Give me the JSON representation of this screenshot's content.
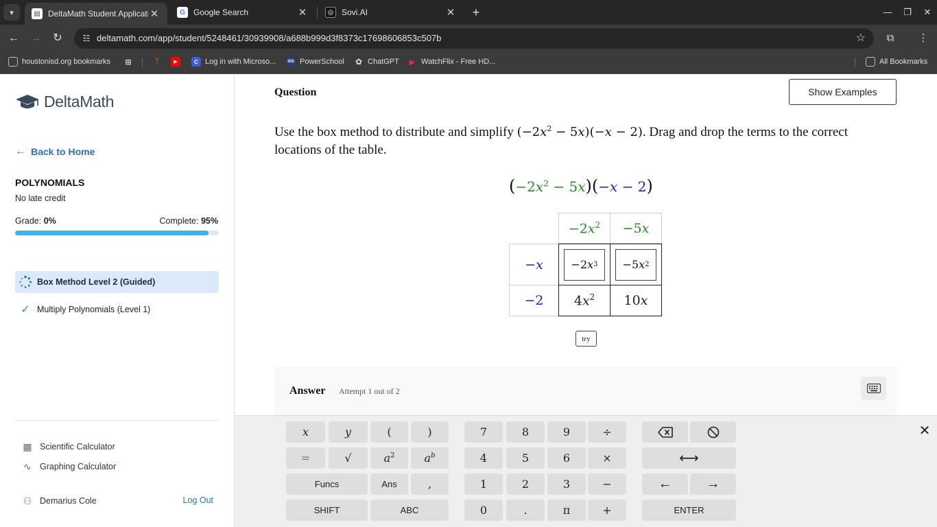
{
  "browser": {
    "tabs": [
      {
        "title": "DeltaMath Student Application",
        "active": true
      },
      {
        "title": "Google Search",
        "active": false
      },
      {
        "title": "Sovi.AI",
        "active": false
      }
    ],
    "url": "deltamath.com/app/student/5248461/30939908/a688b999d3f8373c17698606853c507b",
    "bookmarks": [
      {
        "label": "houstonisd.org bookmarks"
      },
      {
        "label": "Log in with Microso..."
      },
      {
        "label": "PowerSchool"
      },
      {
        "label": "ChatGPT"
      },
      {
        "label": "WatchFlix - Free HD..."
      }
    ],
    "all_bookmarks": "All Bookmarks"
  },
  "sidebar": {
    "brand": "DeltaMath",
    "back_label": "Back to Home",
    "assignment_title": "POLYNOMIALS",
    "assignment_sub": "No late credit",
    "grade_label": "Grade:",
    "grade_value": "0%",
    "complete_label": "Complete:",
    "complete_value": "95%",
    "complete_fraction": 0.95,
    "skills": [
      {
        "label": "Box Method Level 2 (Guided)",
        "status": "in-progress"
      },
      {
        "label": "Multiply Polynomials (Level 1)",
        "status": "complete"
      }
    ],
    "tools": [
      {
        "label": "Scientific Calculator"
      },
      {
        "label": "Graphing Calculator"
      }
    ],
    "user_name": "Demarius Cole",
    "logout_label": "Log Out"
  },
  "question": {
    "heading": "Question",
    "show_examples": "Show Examples",
    "prompt_before": "Use the box method to distribute and simplify ",
    "prompt_after": ". Drag and drop the terms to the correct locations of the table.",
    "try_label": "try"
  },
  "answer": {
    "label": "Answer",
    "attempt": "Attempt 1 out of 2"
  },
  "keyboard": {
    "funcs": "Funcs",
    "ans": "Ans",
    "shift": "SHIFT",
    "abc": "ABC",
    "enter": "ENTER",
    "digits": [
      "7",
      "8",
      "9",
      "4",
      "5",
      "6",
      "1",
      "2",
      "3",
      "0"
    ],
    "dot": ".",
    "comma": ",",
    "equals": "=",
    "divide": "÷",
    "times": "×",
    "minus": "−",
    "plus": "+",
    "pi": "π",
    "sqrt": "√",
    "lparen": "(",
    "rparen": ")",
    "var_x": "x",
    "var_y": "y"
  },
  "colors": {
    "accent": "#2f6fb3",
    "progress": "#3cb4e7",
    "green_terms": "#248a24",
    "blue_terms": "#1c24b8"
  }
}
